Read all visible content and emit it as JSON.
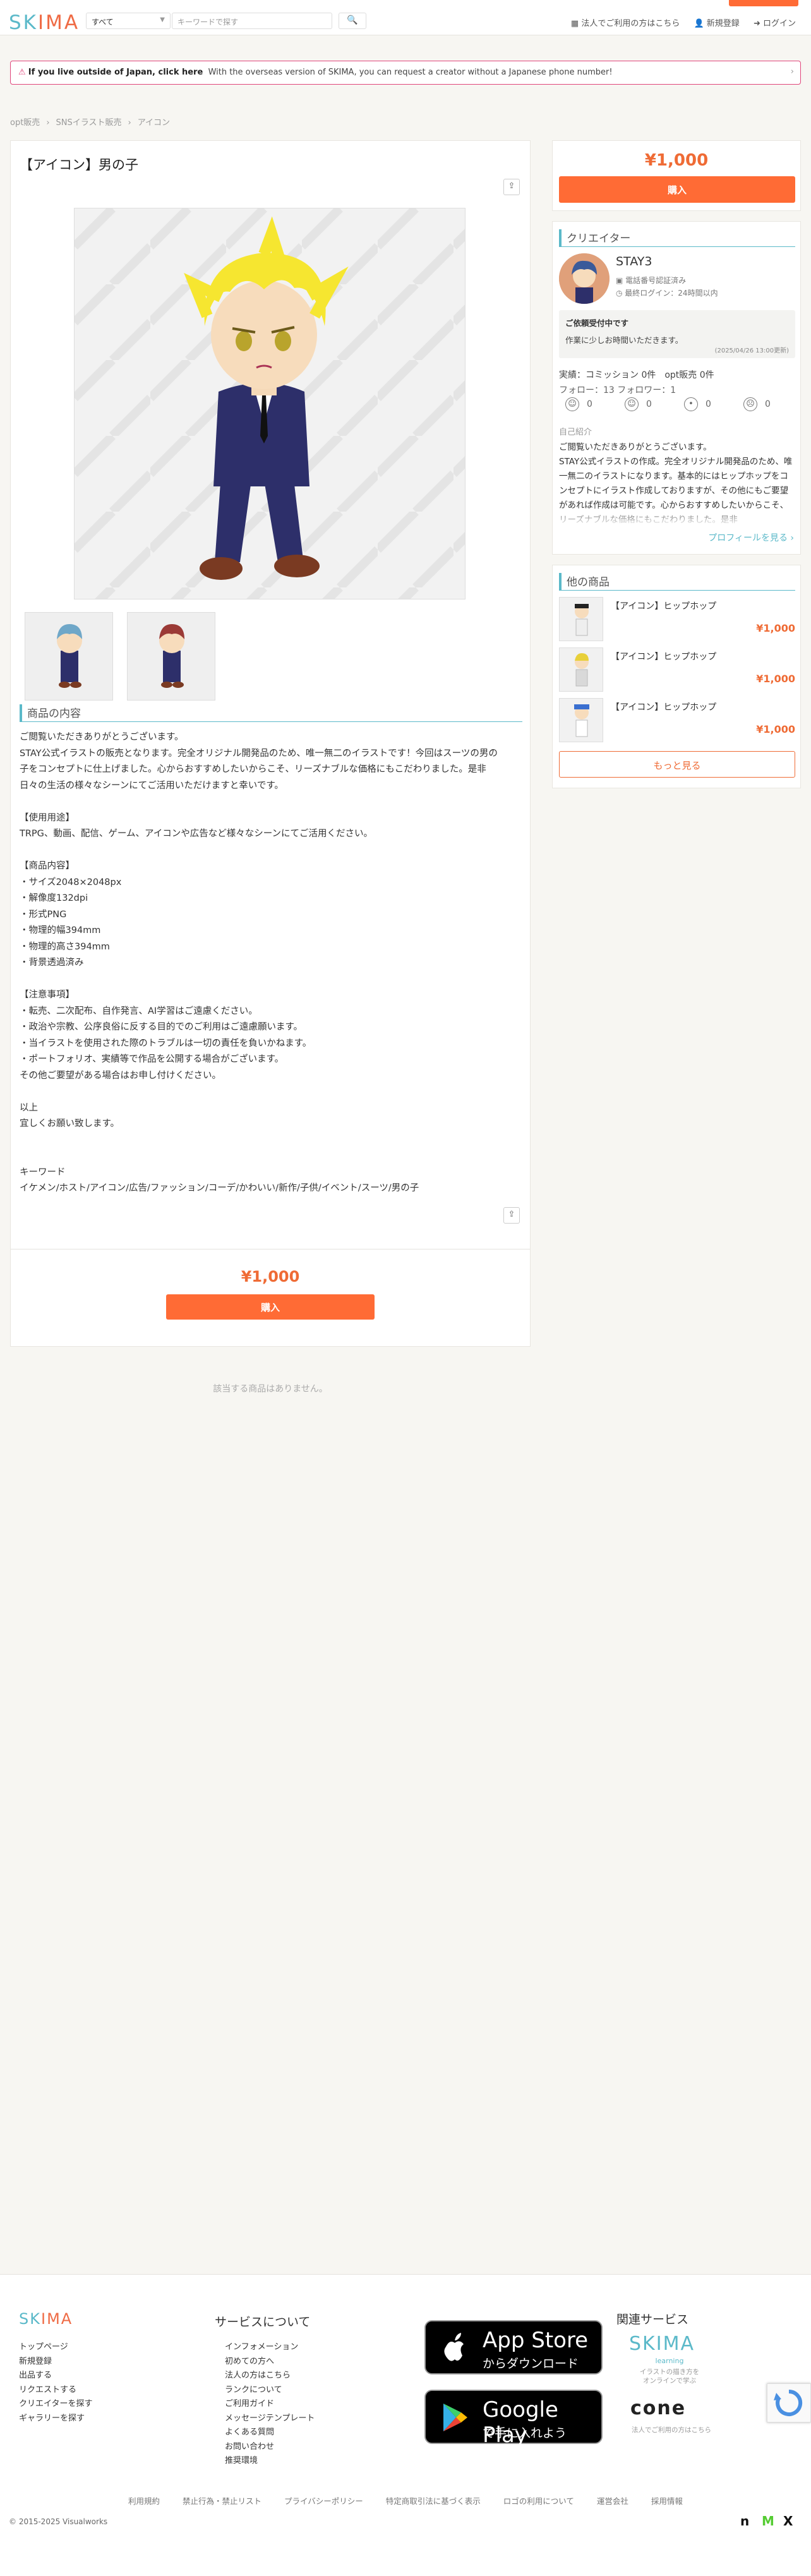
{
  "colors": {
    "brand_teal": "#5bb9c9",
    "brand_orange": "#ef6b45",
    "accent": "#ff6b35",
    "notice_border": "#e0457b"
  },
  "header": {
    "logo_left": "SK",
    "logo_right": "IMA",
    "category_select": "すべて",
    "search_placeholder": "キーワードで探す",
    "links": [
      "法人でご利用の方はこちら",
      "新規登録",
      "ログイン"
    ]
  },
  "notice": {
    "bold": "If you live outside of Japan, click here",
    "text": "With the overseas version of SKIMA, you can request a creator without a Japanese phone number!"
  },
  "breadcrumb": [
    "opt販売",
    "SNSイラスト販売",
    "アイコン"
  ],
  "product": {
    "title": "【アイコン】男の子",
    "section_heading": "商品の内容",
    "description": "ご閲覧いただきありがとうございます。\nSTAY公式イラストの販売となります。完全オリジナル開発品のため、唯一無二のイラストです！今回はスーツの男の\n子をコンセプトに仕上げました。心からおすすめしたいからこそ、リーズナブルな価格にもこだわりました。是非\n日々の生活の様々なシーンにてご活用いただけますと幸いです。\n\n【使用用途】\nTRPG、動画、配信、ゲーム、アイコンや広告など様々なシーンにてご活用ください。\n\n【商品内容】\n・サイズ2048×2048px\n・解像度132dpi\n・形式PNG\n・物理的幅394mm\n・物理的高さ394mm\n・背景透過済み\n\n【注意事項】\n・転売、二次配布、自作発言、AI学習はご遠慮ください。\n・政治や宗教、公序良俗に反する目的でのご利用はご遠慮願います。\n・当イラストを使用された際のトラブルは一切の責任を負いかねます。\n・ポートフォリオ、実績等で作品を公開する場合がございます。\nその他ご要望がある場合はお申し付けください。\n\n以上\n宜しくお願い致します。\n\n\nキーワード\nイケメン/ホスト/アイコン/広告/ファッション/コーデ/かわいい/新作/子供/イベント/スーツ/男の子",
    "price": "¥1,000",
    "buy_label": "購入",
    "no_products": "該当する商品はありません。"
  },
  "creator": {
    "heading": "クリエイター",
    "name": "STAY3",
    "verified": "電話番号認証済み",
    "last_login": "最終ログイン：24時間以内",
    "status_title": "ご依頼受付中です",
    "status_text": "作業に少しお時間いただきます。",
    "status_date": "(2025/04/26 13:00更新)",
    "stats": "実績：コミッション 0件　opt販売 0件",
    "follow": "フォロー：13 フォロワー：1",
    "ratings": [
      "0",
      "0",
      "0",
      "0"
    ],
    "bio_heading": "自己紹介",
    "bio": "ご閲覧いただきありがとうございます。\nSTAY公式イラストの作成。完全オリジナル開発品のため、唯一無二のイラストになります。基本的にはヒップホップをコンセプトにイラスト作成しておりますが、その他にもご要望があれば作成は可能です。心からおすすめしたいからこそ、リーズナブルな価格にもこだわりました。是非",
    "profile_link": "プロフィールを見る ›"
  },
  "other_products": {
    "heading": "他の商品",
    "items": [
      {
        "title": "【アイコン】ヒップホップ",
        "price": "¥1,000"
      },
      {
        "title": "【アイコン】ヒップホップ",
        "price": "¥1,000"
      },
      {
        "title": "【アイコン】ヒップホップ",
        "price": "¥1,000"
      }
    ],
    "more_label": "もっと見る"
  },
  "footer": {
    "logo_left": "SK",
    "logo_right": "IMA",
    "col1": [
      "トップページ",
      "新規登録",
      "出品する",
      "リクエストする",
      "クリエイターを探す",
      "ギャラリーを探す"
    ],
    "services_heading": "サービスについて",
    "col2": [
      "インフォメーション",
      "初めての方へ",
      "法人の方はこちら",
      "ランクについて",
      "ご利用ガイド",
      "メッセージテンプレート",
      "よくある質問",
      "お問い合わせ",
      "推奨環境"
    ],
    "appstore_big": "App Store",
    "appstore_small": "からダウンロード",
    "gplay_big": "Google Play",
    "gplay_small": "で手に入れよう",
    "related_heading": "関連サービス",
    "rel1_logo": "SKIMA",
    "rel1_sub1": "learning",
    "rel1_sub2": "イラストの描き方を",
    "rel1_sub3": "オンラインで学ぶ",
    "rel2_logo": "cone",
    "rel2_sub": "法人でご利用の方はこちら",
    "bottom_links": [
      "利用規約",
      "禁止行為・禁止リスト",
      "プライバシーポリシー",
      "特定商取引法に基づく表示",
      "ロゴの利用について",
      "運営会社",
      "採用情報"
    ],
    "copyright": "© 2015-2025 Visualworks"
  }
}
